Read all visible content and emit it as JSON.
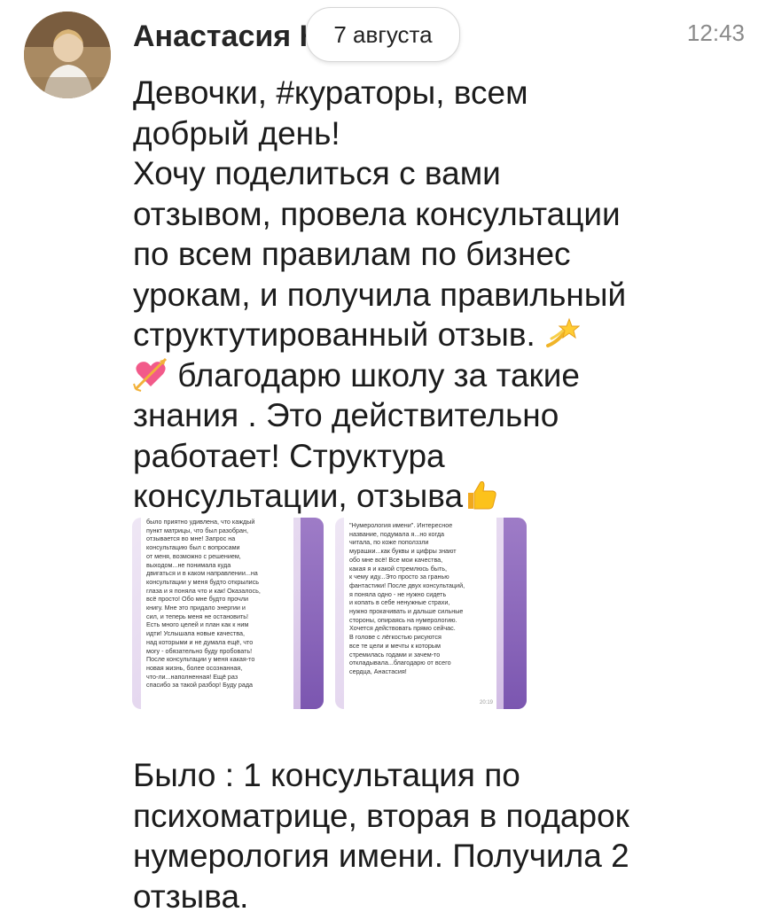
{
  "message": {
    "author": "Анастасия Кондра",
    "date_pill": "7 августа",
    "time": "12:43",
    "avatar_icon": "user-avatar",
    "text_part1": "Девочки, #кураторы, всем\nдобрый день!\n Хочу поделиться с вами\nотзывом, провела консультации\nпо всем правилам по бизнес\nурокам, и получила правильный\nструктутированный отзыв. ",
    "emoji_dizzy": "dizzy-star-icon",
    "emoji_heart": "heart-with-arrow-icon",
    "text_part2": " благодарю школу за такие\nзнания . Это действительно\nработает! Структура\nконсультации, отзыва",
    "emoji_thumb": "thumbs-up-icon",
    "footer": "Было : 1 консультация по\nпсихоматрице, вторая в подарок\nнумерология имени. Получила 2\nотзыва."
  },
  "attachments": [
    {
      "text": "было приятно удивлена, что каждый\nпункт матрицы, что был разобран,\nотзывается во мне! Запрос на\nконсультацию был с вопросами\nот меня, возможно с решением,\nвыходом...не понимала куда\nдвигаться и в каком направлении...на\nконсультации у меня будто открылись\nглаза и я поняла что и как! Оказалось,\nвсё просто! Обо мне будто прочли\nкнигу. Мне это придало энергии и\nсил, и теперь меня не остановить!\nЕсть много целей и план как к ним\nидти! Услышала новые качества,\nнад которыми и не думала ещё, что\nмогу - обязательно буду пробовать!\nПосле консультации у меня какая-то\nновая жизнь, более осознанная,\nчто-ли...наполненная! Ещё раз\nспасибо за такой разбор! Буду рада"
    },
    {
      "text": "\"Нумерология имени\". Интересное\nназвание, подумала я...но когда\nчитала, по коже пополззли\nмурашки...как буквы и цифры знают\nобо мне всё! Все мои качества,\nкакая я и какой стремлюсь быть,\nк чему иду...Это просто за гранью\nфантастики! После двух консультаций,\nя поняла одно - не нужно сидеть\nи копать в себе ненужные страхи,\nнужно прокачивать и дальше сильные\nстороны, опираясь на нумерологию.\nХочется действовать прямо сейчас.\nВ голове с лёгкостью рисуются\nвсе те цели и мечты к которым\nстремилась годами и зачем-то\nоткладывала...благодарю от всего\nсердца, Анастасия!",
      "time": "20:19"
    }
  ]
}
